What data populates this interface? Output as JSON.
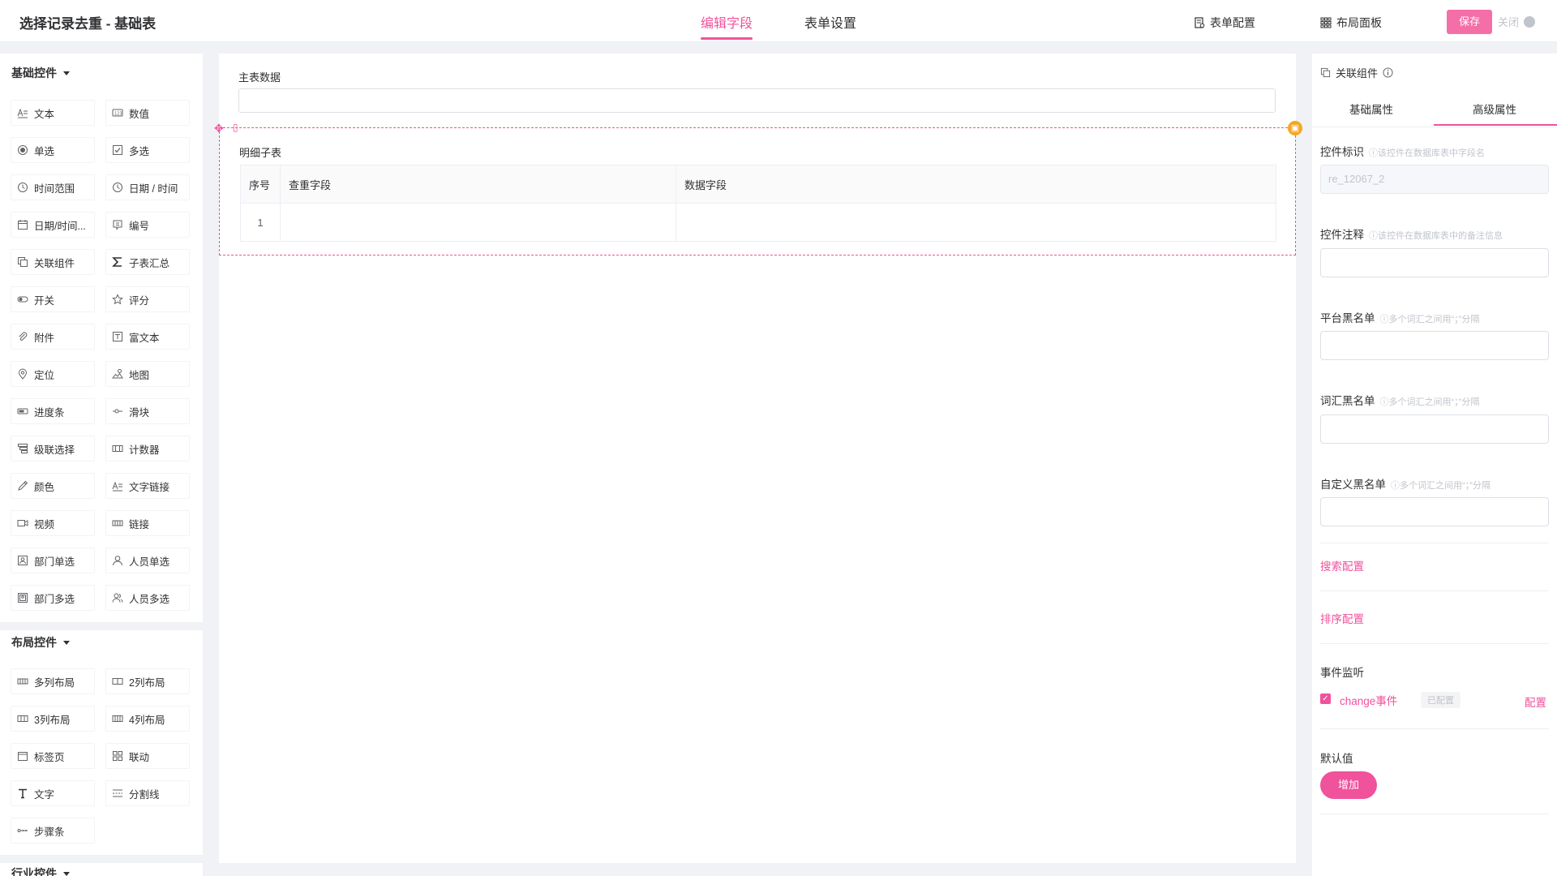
{
  "header": {
    "title": "选择记录去重 - 基础表",
    "tabs": [
      "编辑字段",
      "表单设置"
    ],
    "form_config": "表单配置",
    "layout_panel": "布局面板",
    "save": "保存",
    "close": "关闭"
  },
  "left": {
    "basic_group": "基础控件",
    "basic_items": [
      "文本",
      "数值",
      "单选",
      "多选",
      "时间范围",
      "日期 / 时间",
      "日期/时间...",
      "编号",
      "关联组件",
      "子表汇总",
      "开关",
      "评分",
      "附件",
      "富文本",
      "定位",
      "地图",
      "进度条",
      "滑块",
      "级联选择",
      "计数器",
      "颜色",
      "文字链接",
      "视频",
      "链接",
      "部门单选",
      "人员单选",
      "部门多选",
      "人员多选"
    ],
    "layout_group": "布局控件",
    "layout_items": [
      "多列布局",
      "2列布局",
      "3列布局",
      "4列布局",
      "标签页",
      "联动",
      "文字",
      "分割线",
      "步骤条"
    ],
    "industry_group": "行业控件"
  },
  "canvas": {
    "main_label": "主表数据",
    "sub_label": "明细子表",
    "sub_columns": [
      "序号",
      "查重字段",
      "数据字段"
    ],
    "sub_rows": [
      [
        "1",
        "",
        ""
      ]
    ]
  },
  "right": {
    "head": "关联组件",
    "tabs": [
      "基础属性",
      "高级属性"
    ],
    "id_label": "控件标识",
    "id_hint": "ⓘ该控件在数据库表中字段名",
    "id_value": "re_12067_2",
    "note_label": "控件注释",
    "note_hint": "ⓘ该控件在数据库表中的备注信息",
    "platform_bl_label": "平台黑名单",
    "platform_bl_hint": "ⓘ多个词汇之间用“；”分隔",
    "vocab_bl_label": "词汇黑名单",
    "vocab_bl_hint": "ⓘ多个词汇之间用“；”分隔",
    "custom_bl_label": "自定义黑名单",
    "custom_bl_hint": "ⓘ多个词汇之间用“；”分隔",
    "search_config": "搜索配置",
    "sort_config": "排序配置",
    "event_label": "事件监听",
    "event_name": "change事件",
    "event_status": "已配置",
    "event_config": "配置",
    "default_label": "默认值",
    "add_btn": "增加"
  },
  "colors": {
    "accent": "#f0529c",
    "save_bg": "#f46ea8",
    "delete_badge": "#f5a623"
  }
}
